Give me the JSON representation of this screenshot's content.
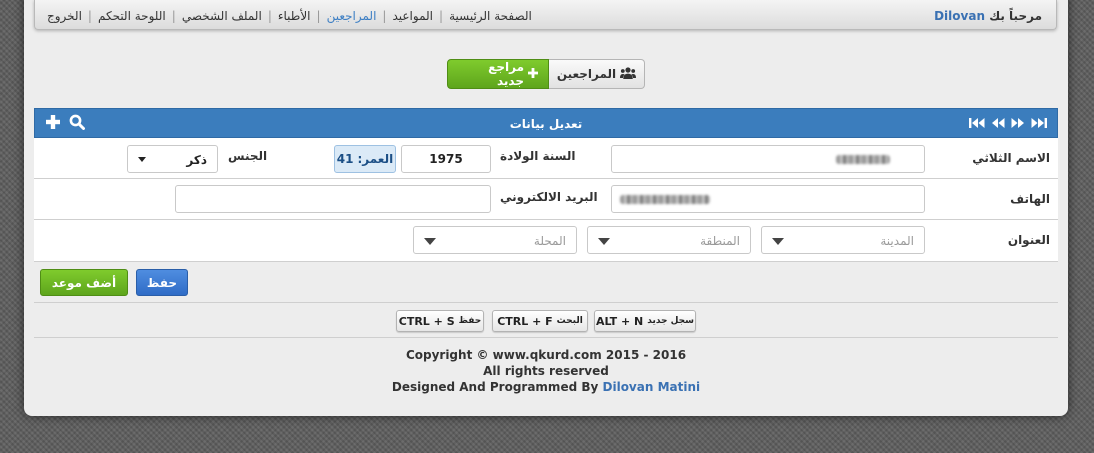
{
  "header": {
    "welcome_prefix": "مرحباً بك",
    "username": "Dilovan",
    "nav": [
      "الصفحة الرئيسية",
      "المواعيد",
      "المراجعين",
      "الأطباء",
      "الملف الشخصي",
      "اللوحة التحكم",
      "الخروج"
    ],
    "active_nav": "المراجعين"
  },
  "buttons": {
    "new_patient": "مراجع جديد",
    "patients": "المراجعين"
  },
  "panel": {
    "title": "تعديل بيانات"
  },
  "form": {
    "full_name_label": "الاسم الثلاثي",
    "birth_year_label": "السنة الولادة",
    "birth_year_value": "1975",
    "age_label": "العمر:",
    "age_value": "41",
    "gender_label": "الجنس",
    "gender_value": "ذكر",
    "phone_label": "الهاتف",
    "email_label": "البريد الالكتروني",
    "email_value": "",
    "address_label": "العنوان",
    "city_placeholder": "المدينة",
    "region_placeholder": "المنطقة",
    "locality_placeholder": "المحلة"
  },
  "actions": {
    "save": "حفظ",
    "add_appointment": "أضف موعد"
  },
  "shortcuts": [
    {
      "keys": "ALT + N",
      "label": "سجل جديد"
    },
    {
      "keys": "CTRL + F",
      "label": "البحث"
    },
    {
      "keys": "CTRL + S",
      "label": "حفظ"
    }
  ],
  "footer": {
    "copyright": "Copyright © www.qkurd.com 2015 - 2016",
    "rights": "All rights reserved",
    "designed_prefix": "Designed And Programmed By",
    "author": "Dilovan Matini"
  },
  "colors": {
    "panel_header": "#3b7dbd",
    "green_button": "#6cb823",
    "save_button": "#3a78d2",
    "active_nav": "#3d7fc4"
  }
}
